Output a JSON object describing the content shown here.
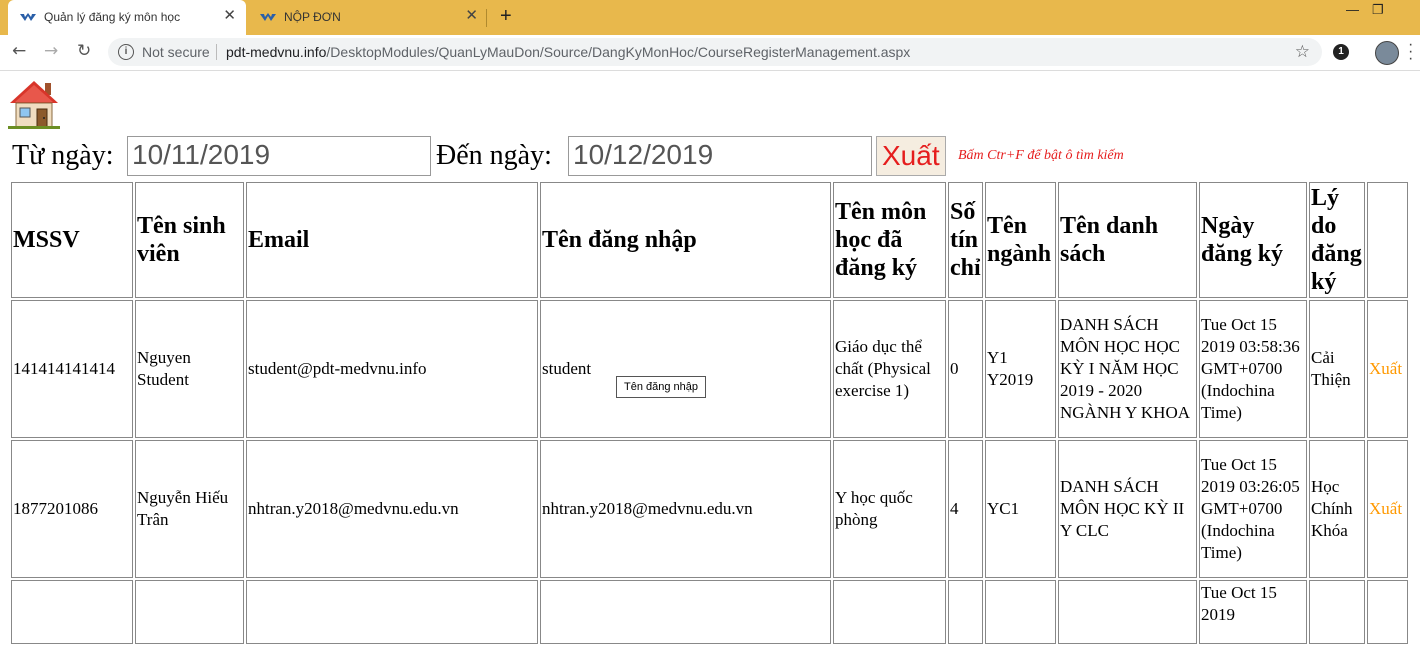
{
  "browser": {
    "tabs": [
      {
        "title": "Quản lý đăng ký môn học",
        "active": true
      },
      {
        "title": "NỘP ĐƠN",
        "active": false
      }
    ],
    "new_tab_symbol": "+",
    "security_label": "Not secure",
    "url_host": "pdt-medvnu.info",
    "url_path": "/DesktopModules/QuanLyMauDon/Source/DangKyMonHoc/CourseRegisterManagement.aspx",
    "extension_badge": "1"
  },
  "filters": {
    "from_label": "Từ ngày:",
    "from_value": "10/11/2019",
    "to_label": "Đến ngày:",
    "to_value": "10/12/2019",
    "export_label": "Xuất",
    "hint": "Bấm Ctr+F để bật ô tìm kiếm"
  },
  "table": {
    "headers": [
      "MSSV",
      "Tên sinh viên",
      "Email",
      "Tên đăng nhập",
      "Tên môn học đã đăng ký",
      "Số tín chỉ",
      "Tên ngành",
      "Tên danh sách",
      "Ngày đăng ký",
      "Lý do đăng ký",
      ""
    ],
    "rows": [
      {
        "mssv": "141414141414",
        "name": "Nguyen Student",
        "email": "student@pdt-medvnu.info",
        "username": "student",
        "course": "Giáo dục thể chất (Physical exercise 1)",
        "credits": "0",
        "major": "Y1 Y2019",
        "list_name": "DANH SÁCH MÔN HỌC HỌC KỲ I NĂM HỌC 2019 - 2020 NGÀNH Y KHOA",
        "date": "Tue Oct 15 2019 03:58:36 GMT+0700 (Indochina Time)",
        "reason": "Cải Thiện",
        "action": "Xuất"
      },
      {
        "mssv": "1877201086",
        "name": "Nguyễn Hiếu Trân",
        "email": "nhtran.y2018@medvnu.edu.vn",
        "username": "nhtran.y2018@medvnu.edu.vn",
        "course": "Y học quốc phòng",
        "credits": "4",
        "major": "YC1",
        "list_name": "DANH SÁCH MÔN HỌC KỲ II Y CLC",
        "date": "Tue Oct 15 2019 03:26:05 GMT+0700 (Indochina Time)",
        "reason": "Học Chính Khóa",
        "action": "Xuất"
      },
      {
        "date": "Tue Oct 15 2019"
      }
    ]
  },
  "tooltip": "Tên đăng nhập"
}
